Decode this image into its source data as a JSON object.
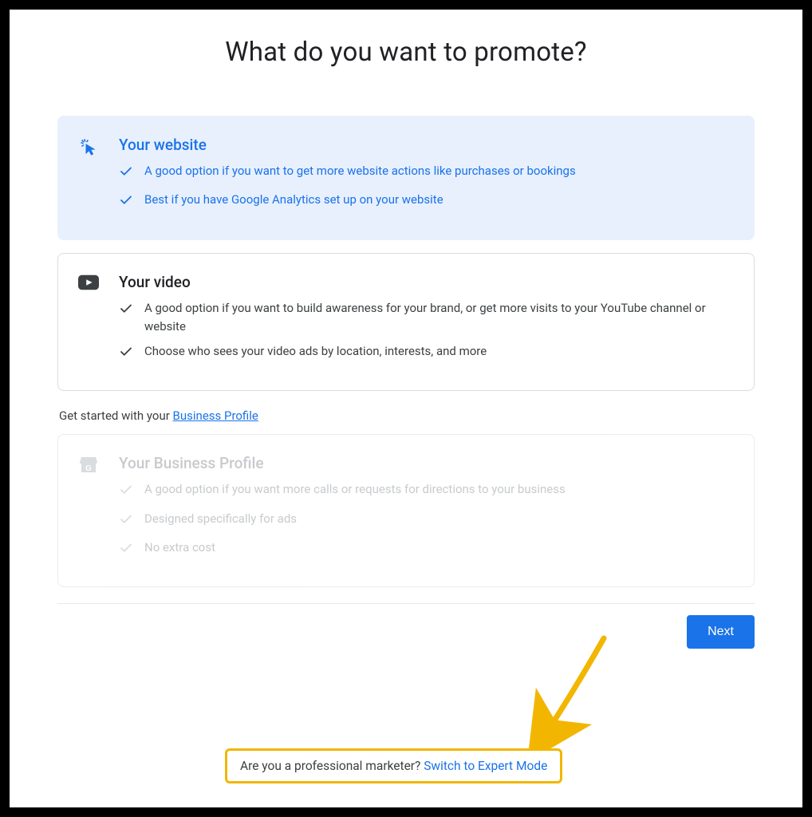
{
  "page_title": "What do you want to promote?",
  "cards": [
    {
      "title": "Your website",
      "bullets": [
        "A good option if you want to get more website actions like purchases or bookings",
        "Best if you have Google Analytics set up on your website"
      ]
    },
    {
      "title": "Your video",
      "bullets": [
        "A good option if you want to build awareness for your brand, or get more visits to your YouTube channel or website",
        "Choose who sees your video ads by location, interests, and more"
      ]
    },
    {
      "title": "Your Business Profile",
      "bullets": [
        "A good option if you want more calls or requests for directions to your business",
        "Designed specifically for ads",
        "No extra cost"
      ]
    }
  ],
  "helper_prefix": "Get started with your ",
  "helper_link": "Business Profile",
  "next_label": "Next",
  "expert_prefix": "Are you a professional marketer? ",
  "expert_link": "Switch to Expert Mode"
}
